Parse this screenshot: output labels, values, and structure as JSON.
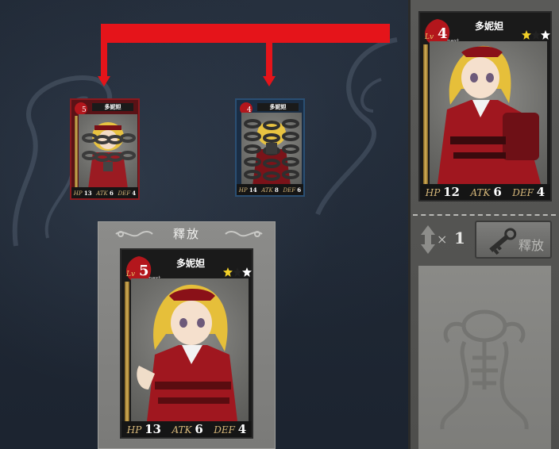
{
  "cards": {
    "left": {
      "name": "多妮妲",
      "level": "5",
      "hp": "13",
      "atk": "6",
      "def": "4"
    },
    "right": {
      "name": "多妮妲",
      "level": "4",
      "hp": "14",
      "atk": "8",
      "def": "6"
    },
    "preview": {
      "name": "多妮妲",
      "level": "5",
      "next_label": "next",
      "lv_label": "Lv",
      "hp_label": "HP",
      "hp": "13",
      "atk_label": "ATK",
      "atk": "6",
      "def_label": "DEF",
      "def": "4"
    },
    "selected": {
      "name": "多妮妲",
      "level": "4",
      "next_label": "next",
      "lv_label": "Lv",
      "hp_label": "HP",
      "hp": "12",
      "atk_label": "ATK",
      "atk": "6",
      "def_label": "DEF",
      "def": "4"
    }
  },
  "release_panel": {
    "title": "釋放"
  },
  "sidebar": {
    "multiplier_sign": "×",
    "count": "1",
    "release_button_label": "釋放"
  },
  "colors": {
    "connector": "#e5141a",
    "frame_red": "#8c1a1f",
    "frame_blue": "#2a4f73",
    "gold": "#d8b35a"
  },
  "icons": [
    "dpad-icon",
    "key-icon",
    "frog-emblem-icon",
    "star-icon",
    "chain-icon",
    "blood-splat-icon"
  ]
}
